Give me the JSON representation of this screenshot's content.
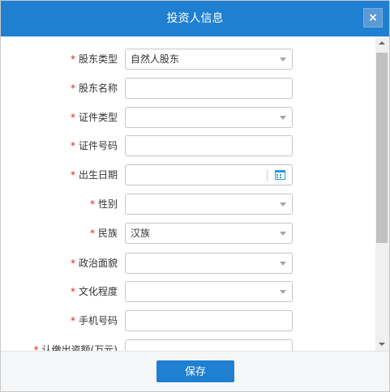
{
  "dialog": {
    "title": "投资人信息",
    "close_label": "×",
    "save_label": "保存",
    "accent_color": "#1f7fd0"
  },
  "form": {
    "required_marker": "*",
    "fields": [
      {
        "label": "股东类型",
        "type": "select",
        "value": "自然人股东"
      },
      {
        "label": "股东名称",
        "type": "text",
        "value": ""
      },
      {
        "label": "证件类型",
        "type": "select",
        "value": ""
      },
      {
        "label": "证件号码",
        "type": "text",
        "value": ""
      },
      {
        "label": "出生日期",
        "type": "date",
        "value": "",
        "icon": "calendar-icon"
      },
      {
        "label": "性别",
        "type": "select",
        "value": ""
      },
      {
        "label": "民族",
        "type": "select",
        "value": "汉族"
      },
      {
        "label": "政治面貌",
        "type": "select",
        "value": ""
      },
      {
        "label": "文化程度",
        "type": "select",
        "value": ""
      },
      {
        "label": "手机号码",
        "type": "text",
        "value": ""
      },
      {
        "label": "认缴出资额(万元)",
        "type": "text",
        "value": ""
      }
    ]
  }
}
